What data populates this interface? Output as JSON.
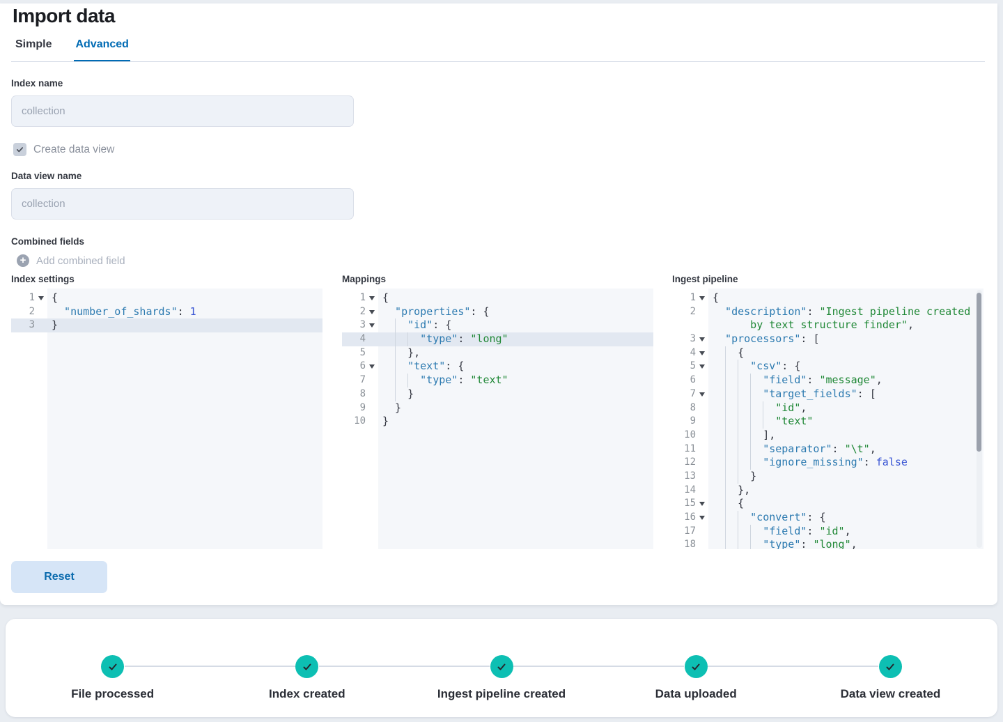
{
  "page": {
    "title": "Import data"
  },
  "tabs": [
    {
      "label": "Simple",
      "active": false
    },
    {
      "label": "Advanced",
      "active": true
    }
  ],
  "form": {
    "index_name_label": "Index name",
    "index_name_placeholder": "collection",
    "create_data_view_label": "Create data view",
    "create_data_view_checked": true,
    "data_view_name_label": "Data view name",
    "data_view_name_placeholder": "collection",
    "combined_fields_label": "Combined fields",
    "add_combined_field_label": "Add combined field"
  },
  "reset_button_label": "Reset",
  "colors": {
    "accent_blue": "#006bb4",
    "success_teal": "#0dbfb3",
    "syntax_key": "#2c7ab0",
    "syntax_string": "#208836",
    "syntax_number": "#3a56d4",
    "active_line": "#e2e8f1",
    "editor_background": "#f5f7fa"
  },
  "editors": [
    {
      "label": "Index settings",
      "has_scrollbar": false,
      "lines": [
        {
          "n": "1",
          "fold": true,
          "sp": 0,
          "g": 0,
          "t": [
            [
              "tp",
              "{"
            ]
          ]
        },
        {
          "n": "2",
          "fold": false,
          "sp": 1,
          "g": 0,
          "t": [
            [
              "tk",
              "\"number_of_shards\""
            ],
            [
              "tp",
              ": "
            ],
            [
              "tn",
              "1"
            ]
          ]
        },
        {
          "n": "3",
          "fold": false,
          "sp": 0,
          "g": 0,
          "active": true,
          "t": [
            [
              "tp",
              "}"
            ]
          ]
        }
      ]
    },
    {
      "label": "Mappings",
      "has_scrollbar": false,
      "lines": [
        {
          "n": "1",
          "fold": true,
          "sp": 0,
          "g": 0,
          "t": [
            [
              "tp",
              "{"
            ]
          ]
        },
        {
          "n": "2",
          "fold": true,
          "sp": 1,
          "g": 0,
          "t": [
            [
              "tk",
              "\"properties\""
            ],
            [
              "tp",
              ": {"
            ]
          ]
        },
        {
          "n": "3",
          "fold": true,
          "sp": 1,
          "g": 1,
          "t": [
            [
              "tk",
              "\"id\""
            ],
            [
              "tp",
              ": {"
            ]
          ]
        },
        {
          "n": "4",
          "fold": false,
          "sp": 1,
          "g": 2,
          "active": true,
          "t": [
            [
              "tk",
              "\"type\""
            ],
            [
              "tp",
              ": "
            ],
            [
              "ts",
              "\"long\""
            ]
          ]
        },
        {
          "n": "5",
          "fold": false,
          "sp": 1,
          "g": 1,
          "t": [
            [
              "tp",
              "},"
            ]
          ]
        },
        {
          "n": "6",
          "fold": true,
          "sp": 1,
          "g": 1,
          "t": [
            [
              "tk",
              "\"text\""
            ],
            [
              "tp",
              ": {"
            ]
          ]
        },
        {
          "n": "7",
          "fold": false,
          "sp": 1,
          "g": 2,
          "t": [
            [
              "tk",
              "\"type\""
            ],
            [
              "tp",
              ": "
            ],
            [
              "ts",
              "\"text\""
            ]
          ]
        },
        {
          "n": "8",
          "fold": false,
          "sp": 1,
          "g": 1,
          "t": [
            [
              "tp",
              "}"
            ]
          ]
        },
        {
          "n": "9",
          "fold": false,
          "sp": 1,
          "g": 0,
          "t": [
            [
              "tp",
              "}"
            ]
          ]
        },
        {
          "n": "10",
          "fold": false,
          "sp": 0,
          "g": 0,
          "t": [
            [
              "tp",
              "}"
            ]
          ]
        }
      ]
    },
    {
      "label": "Ingest pipeline",
      "has_scrollbar": true,
      "lines": [
        {
          "n": "1",
          "fold": true,
          "sp": 0,
          "g": 0,
          "t": [
            [
              "tp",
              "{"
            ]
          ]
        },
        {
          "n": "2",
          "fold": false,
          "sp": 1,
          "g": 0,
          "t": [
            [
              "tk",
              "\"description\""
            ],
            [
              "tp",
              ": "
            ],
            [
              "ts",
              "\"Ingest pipeline created"
            ]
          ]
        },
        {
          "n": "",
          "fold": false,
          "sp": 3,
          "g": 0,
          "t": [
            [
              "ts",
              "by text structure finder\""
            ],
            [
              "tp",
              ","
            ]
          ]
        },
        {
          "n": "3",
          "fold": true,
          "sp": 1,
          "g": 0,
          "t": [
            [
              "tk",
              "\"processors\""
            ],
            [
              "tp",
              ": ["
            ]
          ]
        },
        {
          "n": "4",
          "fold": true,
          "sp": 1,
          "g": 1,
          "t": [
            [
              "tp",
              "{"
            ]
          ]
        },
        {
          "n": "5",
          "fold": true,
          "sp": 1,
          "g": 2,
          "t": [
            [
              "tk",
              "\"csv\""
            ],
            [
              "tp",
              ": {"
            ]
          ]
        },
        {
          "n": "6",
          "fold": false,
          "sp": 1,
          "g": 3,
          "t": [
            [
              "tk",
              "\"field\""
            ],
            [
              "tp",
              ": "
            ],
            [
              "ts",
              "\"message\""
            ],
            [
              "tp",
              ","
            ]
          ]
        },
        {
          "n": "7",
          "fold": true,
          "sp": 1,
          "g": 3,
          "t": [
            [
              "tk",
              "\"target_fields\""
            ],
            [
              "tp",
              ": ["
            ]
          ]
        },
        {
          "n": "8",
          "fold": false,
          "sp": 1,
          "g": 4,
          "t": [
            [
              "ts",
              "\"id\""
            ],
            [
              "tp",
              ","
            ]
          ]
        },
        {
          "n": "9",
          "fold": false,
          "sp": 1,
          "g": 4,
          "t": [
            [
              "ts",
              "\"text\""
            ]
          ]
        },
        {
          "n": "10",
          "fold": false,
          "sp": 1,
          "g": 3,
          "t": [
            [
              "tp",
              "],"
            ]
          ]
        },
        {
          "n": "11",
          "fold": false,
          "sp": 1,
          "g": 3,
          "t": [
            [
              "tk",
              "\"separator\""
            ],
            [
              "tp",
              ": "
            ],
            [
              "ts",
              "\"\\t\""
            ],
            [
              "tp",
              ","
            ]
          ]
        },
        {
          "n": "12",
          "fold": false,
          "sp": 1,
          "g": 3,
          "t": [
            [
              "tk",
              "\"ignore_missing\""
            ],
            [
              "tp",
              ": "
            ],
            [
              "tn",
              "false"
            ]
          ]
        },
        {
          "n": "13",
          "fold": false,
          "sp": 1,
          "g": 2,
          "t": [
            [
              "tp",
              "}"
            ]
          ]
        },
        {
          "n": "14",
          "fold": false,
          "sp": 1,
          "g": 1,
          "t": [
            [
              "tp",
              "},"
            ]
          ]
        },
        {
          "n": "15",
          "fold": true,
          "sp": 1,
          "g": 1,
          "t": [
            [
              "tp",
              "{"
            ]
          ]
        },
        {
          "n": "16",
          "fold": true,
          "sp": 1,
          "g": 2,
          "t": [
            [
              "tk",
              "\"convert\""
            ],
            [
              "tp",
              ": {"
            ]
          ]
        },
        {
          "n": "17",
          "fold": false,
          "sp": 1,
          "g": 3,
          "t": [
            [
              "tk",
              "\"field\""
            ],
            [
              "tp",
              ": "
            ],
            [
              "ts",
              "\"id\""
            ],
            [
              "tp",
              ","
            ]
          ]
        },
        {
          "n": "18",
          "fold": false,
          "sp": 1,
          "g": 3,
          "t": [
            [
              "tk",
              "\"type\""
            ],
            [
              "tp",
              ": "
            ],
            [
              "ts",
              "\"long\""
            ],
            [
              "tp",
              ","
            ]
          ]
        }
      ]
    }
  ],
  "steps": [
    {
      "label": "File processed",
      "state": "complete"
    },
    {
      "label": "Index created",
      "state": "complete"
    },
    {
      "label": "Ingest pipeline created",
      "state": "complete"
    },
    {
      "label": "Data uploaded",
      "state": "complete"
    },
    {
      "label": "Data view created",
      "state": "complete"
    }
  ]
}
